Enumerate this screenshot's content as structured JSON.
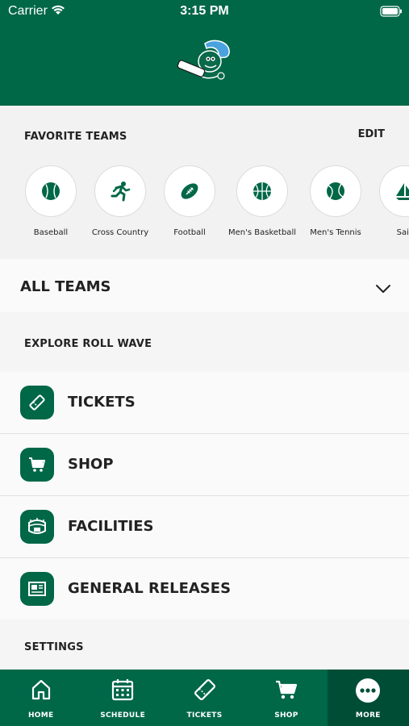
{
  "status_bar": {
    "carrier": "Carrier",
    "time": "3:15 PM"
  },
  "favorites": {
    "title": "FAVORITE TEAMS",
    "edit_label": "EDIT",
    "teams": [
      {
        "label": "Baseball",
        "icon": "baseball-icon"
      },
      {
        "label": "Cross Country",
        "icon": "runner-icon"
      },
      {
        "label": "Football",
        "icon": "football-icon"
      },
      {
        "label": "Men's Basketball",
        "icon": "basketball-icon"
      },
      {
        "label": "Men's Tennis",
        "icon": "tennis-ball-icon"
      },
      {
        "label": "Saili",
        "icon": "sailboat-icon"
      }
    ]
  },
  "all_teams": {
    "label": "ALL TEAMS"
  },
  "explore": {
    "title": "EXPLORE ROLL WAVE",
    "items": [
      {
        "label": "TICKETS",
        "icon": "ticket-icon"
      },
      {
        "label": "SHOP",
        "icon": "cart-icon"
      },
      {
        "label": "FACILITIES",
        "icon": "stadium-icon"
      },
      {
        "label": "GENERAL RELEASES",
        "icon": "newspaper-icon"
      }
    ]
  },
  "settings": {
    "title": "SETTINGS"
  },
  "tabbar": {
    "tabs": [
      {
        "label": "HOME",
        "icon": "home-icon"
      },
      {
        "label": "SCHEDULE",
        "icon": "calendar-icon"
      },
      {
        "label": "TICKETS",
        "icon": "ticket-icon"
      },
      {
        "label": "SHOP",
        "icon": "cart-icon"
      },
      {
        "label": "MORE",
        "icon": "more-icon",
        "active": true
      }
    ]
  },
  "colors": {
    "brand_green": "#006747",
    "active_tab": "#004d36",
    "accent_blue": "#4aa3df"
  }
}
